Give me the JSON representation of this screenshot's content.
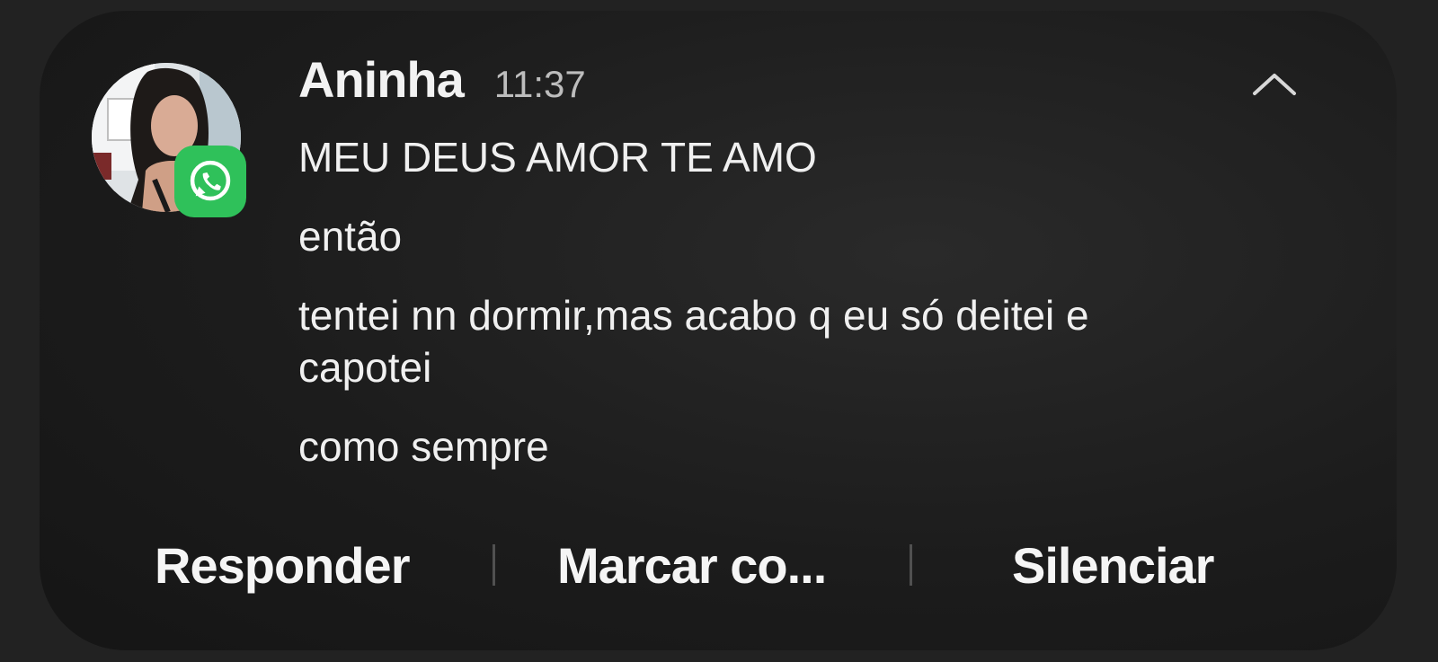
{
  "notification": {
    "app_icon": "whatsapp-icon",
    "sender": "Aninha",
    "time": "11:37",
    "messages": [
      "MEU DEUS AMOR TE AMO",
      "então",
      "tentei nn dormir,mas acabo q eu só deitei e capotei",
      "como sempre"
    ],
    "collapse_icon": "chevron-up-icon"
  },
  "actions": {
    "reply_label": "Responder",
    "mark_label": "Marcar co...",
    "mute_label": "Silenciar"
  },
  "colors": {
    "background": "#1c1c1c",
    "text": "#f0f0f0",
    "time": "#bdbdbd",
    "whatsapp_green": "#2fc15a",
    "separator": "#505050"
  }
}
